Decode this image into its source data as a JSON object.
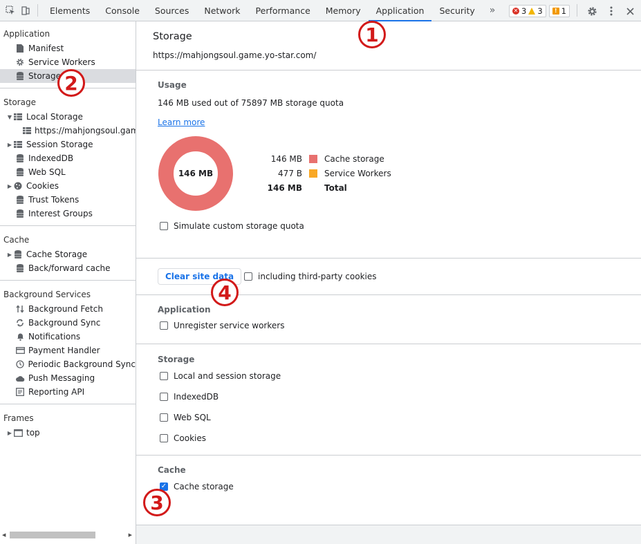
{
  "toolbar": {
    "tabs": [
      "Elements",
      "Console",
      "Sources",
      "Network",
      "Performance",
      "Memory",
      "Application",
      "Security"
    ],
    "active_tab": "Application",
    "more_tabs_glyph": "»",
    "error_count": "3",
    "warning_count": "3",
    "info_count": "1"
  },
  "sidebar": {
    "application": {
      "header": "Application",
      "items": [
        {
          "label": "Manifest",
          "icon": "file-icon"
        },
        {
          "label": "Service Workers",
          "icon": "gear-icon"
        },
        {
          "label": "Storage",
          "icon": "database-icon"
        }
      ]
    },
    "storage": {
      "header": "Storage",
      "items": [
        {
          "label": "Local Storage",
          "icon": "grid-icon",
          "expanded": true
        },
        {
          "label": "https://mahjongsoul.game.y",
          "icon": "grid-icon"
        },
        {
          "label": "Session Storage",
          "icon": "grid-icon"
        },
        {
          "label": "IndexedDB",
          "icon": "database-icon"
        },
        {
          "label": "Web SQL",
          "icon": "database-icon"
        },
        {
          "label": "Cookies",
          "icon": "cookie-icon"
        },
        {
          "label": "Trust Tokens",
          "icon": "database-icon"
        },
        {
          "label": "Interest Groups",
          "icon": "database-icon"
        }
      ]
    },
    "cache": {
      "header": "Cache",
      "items": [
        {
          "label": "Cache Storage",
          "icon": "database-icon"
        },
        {
          "label": "Back/forward cache",
          "icon": "database-icon"
        }
      ]
    },
    "background": {
      "header": "Background Services",
      "items": [
        {
          "label": "Background Fetch",
          "icon": "arrows-updown-icon"
        },
        {
          "label": "Background Sync",
          "icon": "sync-icon"
        },
        {
          "label": "Notifications",
          "icon": "bell-icon"
        },
        {
          "label": "Payment Handler",
          "icon": "card-icon"
        },
        {
          "label": "Periodic Background Sync",
          "icon": "clock-icon"
        },
        {
          "label": "Push Messaging",
          "icon": "cloud-icon"
        },
        {
          "label": "Reporting API",
          "icon": "document-icon"
        }
      ]
    },
    "frames": {
      "header": "Frames",
      "items": [
        {
          "label": "top",
          "icon": "frame-icon"
        }
      ]
    }
  },
  "main": {
    "title": "Storage",
    "url": "https://mahjongsoul.game.yo-star.com/",
    "usage": {
      "title": "Usage",
      "summary": "146 MB used out of 75897 MB storage quota",
      "learn_more": "Learn more",
      "donut_label": "146 MB",
      "legend": [
        {
          "value": "146 MB",
          "label": "Cache storage",
          "color": "#e8716f"
        },
        {
          "value": "477 B",
          "label": "Service Workers",
          "color": "#f9a825"
        },
        {
          "value": "146 MB",
          "label": "Total",
          "color": ""
        }
      ],
      "simulate_quota": "Simulate custom storage quota"
    },
    "clear_button": "Clear site data",
    "third_party": "including third-party cookies",
    "application_section": {
      "title": "Application",
      "items": [
        {
          "label": "Unregister service workers",
          "checked": false
        }
      ]
    },
    "storage_section": {
      "title": "Storage",
      "items": [
        {
          "label": "Local and session storage",
          "checked": false
        },
        {
          "label": "IndexedDB",
          "checked": false
        },
        {
          "label": "Web SQL",
          "checked": false
        },
        {
          "label": "Cookies",
          "checked": false
        }
      ]
    },
    "cache_section": {
      "title": "Cache",
      "items": [
        {
          "label": "Cache storage",
          "checked": true
        }
      ]
    }
  },
  "annotations": [
    "1",
    "2",
    "3",
    "4"
  ],
  "colors": {
    "annotation": "#d21919",
    "accent": "#1a73e8",
    "cache_storage": "#e8716f",
    "service_workers": "#f9a825"
  }
}
